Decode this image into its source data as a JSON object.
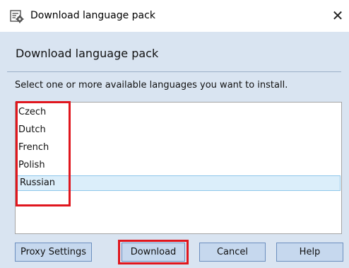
{
  "window": {
    "title": "Download language pack",
    "close_symbol": "✕",
    "icon": "download-language-pack-icon"
  },
  "dialog": {
    "heading": "Download language pack",
    "instruction": "Select one or more available languages you want to install."
  },
  "languages": [
    {
      "label": "Czech",
      "selected": false
    },
    {
      "label": "Dutch",
      "selected": false
    },
    {
      "label": "French",
      "selected": false
    },
    {
      "label": "Polish",
      "selected": false
    },
    {
      "label": "Russian",
      "selected": true
    }
  ],
  "buttons": {
    "proxy_settings": "Proxy Settings",
    "download": "Download",
    "cancel": "Cancel",
    "help": "Help"
  },
  "colors": {
    "dialog_background": "#d9e4f1",
    "button_fill": "#c6d8ee",
    "selection_fill": "#dbeefa",
    "highlight": "#e0161e"
  }
}
